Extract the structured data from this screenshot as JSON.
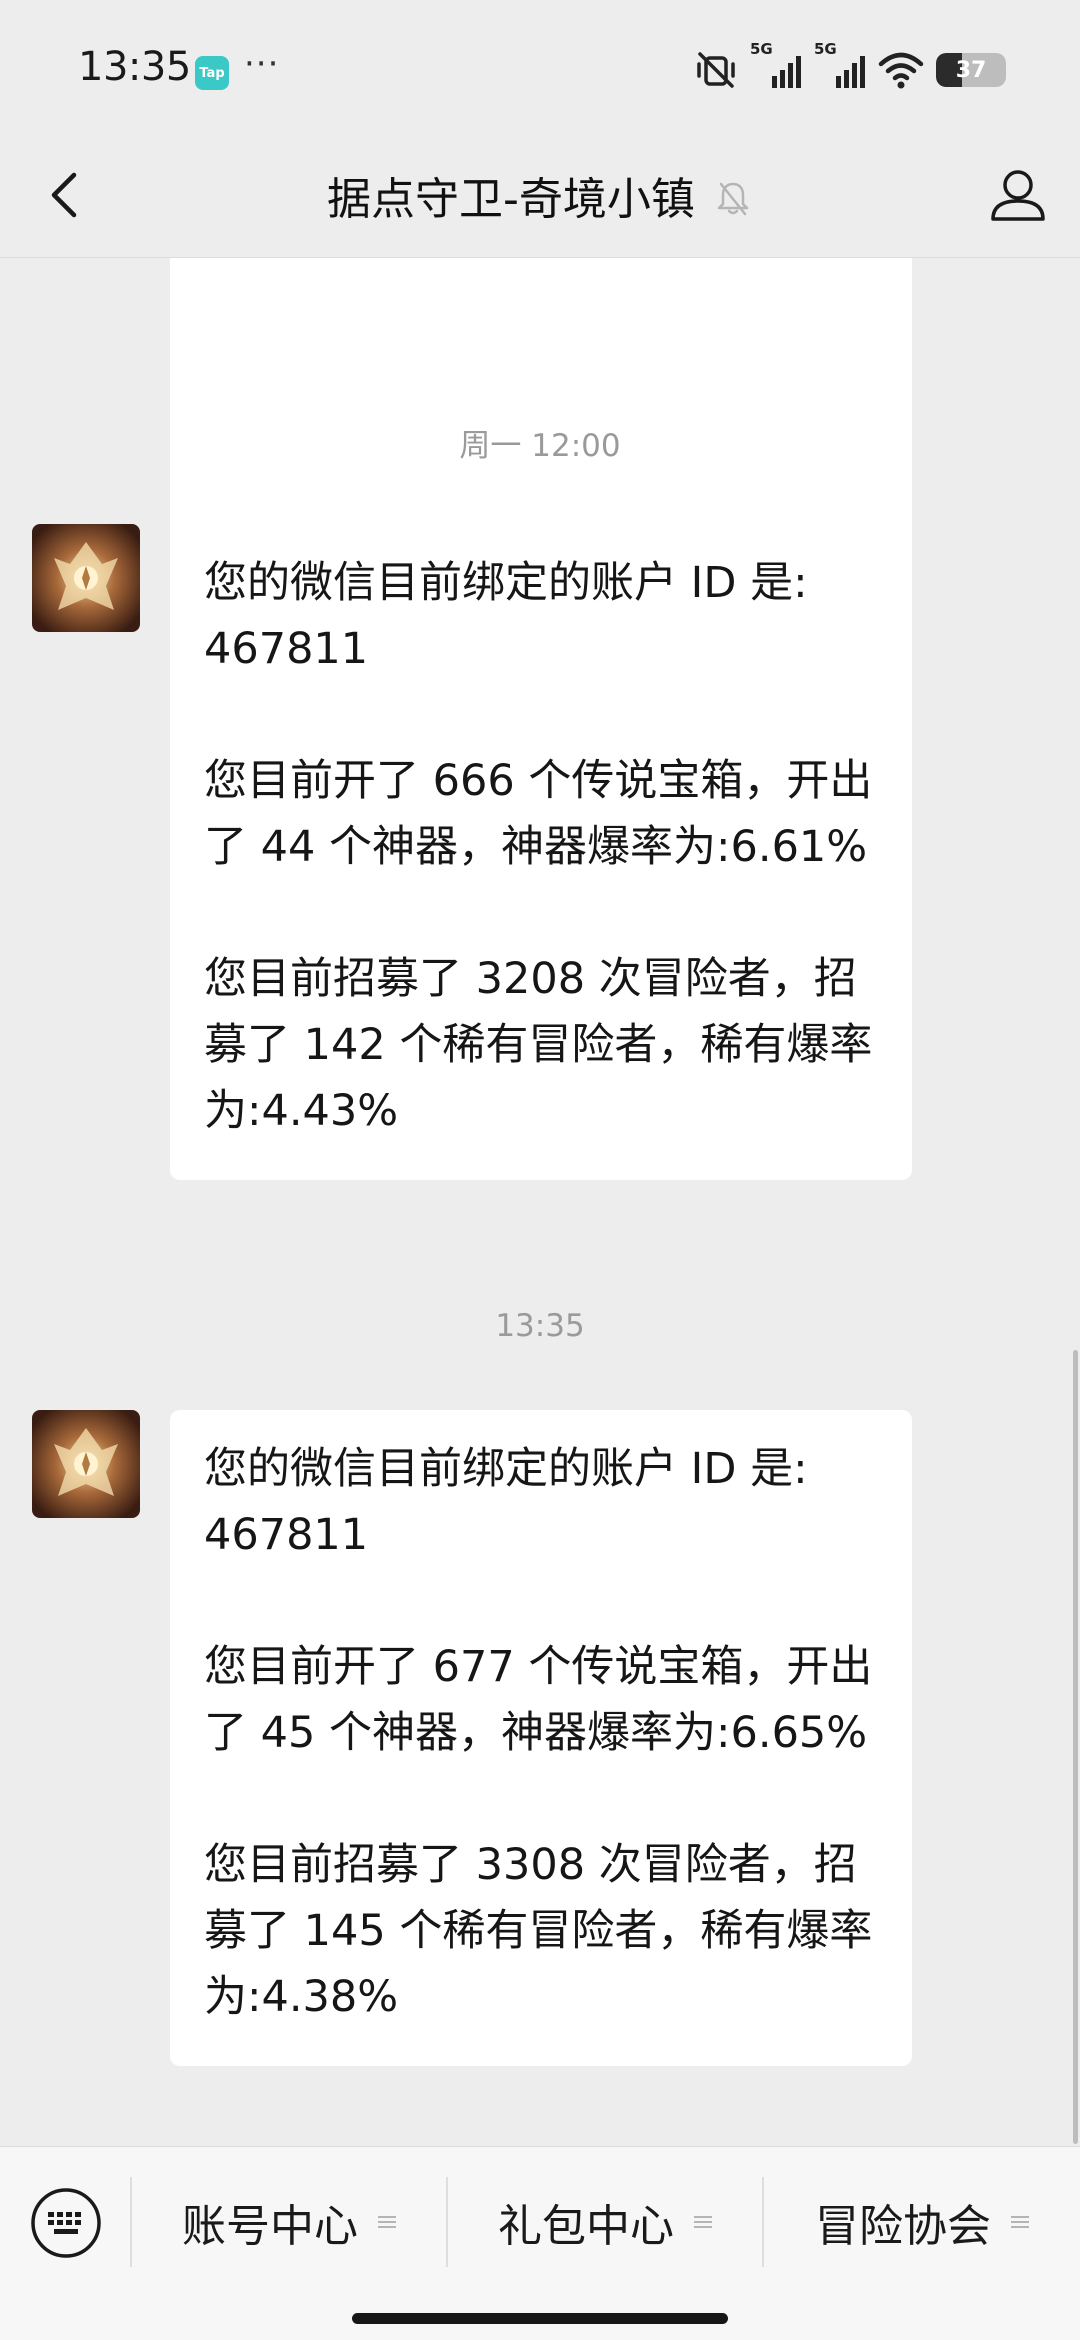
{
  "status_bar": {
    "time": "13:35",
    "app_badge": "Tap",
    "more": "···",
    "signal1_label": "5G",
    "signal2_label": "5G",
    "battery_level": "37"
  },
  "nav": {
    "title": "据点守卫-奇境小镇"
  },
  "chat": {
    "messages": [
      {
        "timestamp": "周一 12:00",
        "lines": [
          "您的微信目前绑定的账户 ID 是: 467811",
          "您目前开了 666 个传说宝箱，开出了 44 个神器，神器爆率为:6.61%",
          "您目前招募了 3208 次冒险者，招募了 142 个稀有冒险者，稀有爆率为:4.43%"
        ]
      },
      {
        "timestamp": "13:35",
        "lines": [
          "您的微信目前绑定的账户 ID 是: 467811",
          "您目前开了 677 个传说宝箱，开出了 45 个神器，神器爆率为:6.65%",
          "您目前招募了 3308 次冒险者，招募了 145 个稀有冒险者，稀有爆率为:4.38%"
        ]
      }
    ]
  },
  "menu": {
    "items": [
      {
        "label": "账号中心"
      },
      {
        "label": "礼包中心"
      },
      {
        "label": "冒险协会"
      }
    ]
  },
  "colors": {
    "background": "#ededed",
    "bubble": "#ffffff",
    "timestamp": "#9a9a9a",
    "app_badge": "#3ac9c6"
  }
}
